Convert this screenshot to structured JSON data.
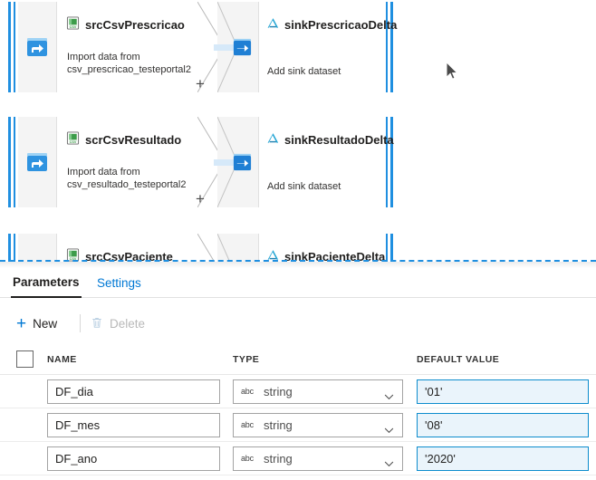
{
  "canvas": {
    "cards": [
      {
        "source_icon": "csv-file-icon",
        "source_name": "srcCsvPrescricao",
        "source_desc": "Import data from\ncsv_prescricao_testeportal2",
        "node_icon": "source-node-icon",
        "add_label": "+",
        "sink_icon": "delta-lake-icon",
        "sink_node_icon": "sink-node-icon",
        "sink_name": "sinkPrescricaoDelta",
        "sink_desc": "Add sink dataset"
      },
      {
        "source_icon": "csv-file-icon",
        "source_name": "scrCsvResultado",
        "source_desc": "Import data from\ncsv_resultado_testeportal2",
        "node_icon": "source-node-icon",
        "add_label": "+",
        "sink_icon": "delta-lake-icon",
        "sink_node_icon": "sink-node-icon",
        "sink_name": "sinkResultadoDelta",
        "sink_desc": "Add sink dataset"
      },
      {
        "source_icon": "csv-file-icon",
        "source_name": "srcCsvPaciente",
        "source_desc": "",
        "node_icon": "source-node-icon",
        "add_label": "+",
        "sink_icon": "delta-lake-icon",
        "sink_node_icon": "sink-node-icon",
        "sink_name": "sinkPacienteDelta",
        "sink_desc": ""
      }
    ]
  },
  "panel": {
    "tabs": [
      {
        "label": "Parameters",
        "active": true
      },
      {
        "label": "Settings",
        "active": false
      }
    ],
    "commands": {
      "new_label": "New",
      "new_icon": "plus-icon",
      "delete_label": "Delete",
      "delete_icon": "trash-icon",
      "delete_disabled": true
    },
    "grid": {
      "select_all_icon": "checkbox-unchecked-icon",
      "columns": [
        "NAME",
        "TYPE",
        "DEFAULT VALUE"
      ],
      "rows": [
        {
          "name": "DF_dia",
          "type": "string",
          "type_icon": "abc-icon",
          "value": "'01'"
        },
        {
          "name": "DF_mes",
          "type": "string",
          "type_icon": "abc-icon",
          "value": "'08'"
        },
        {
          "name": "DF_ano",
          "type": "string",
          "type_icon": "abc-icon",
          "value": "'2020'"
        }
      ]
    }
  },
  "cursor": {
    "icon": "mouse-pointer-icon"
  },
  "colors": {
    "accent_blue": "#0078d4",
    "rail_blue": "#1f8fe0",
    "delta_cyan": "#22a5d4",
    "value_border": "#0d8ccd",
    "value_fill": "#eaf4fb"
  }
}
